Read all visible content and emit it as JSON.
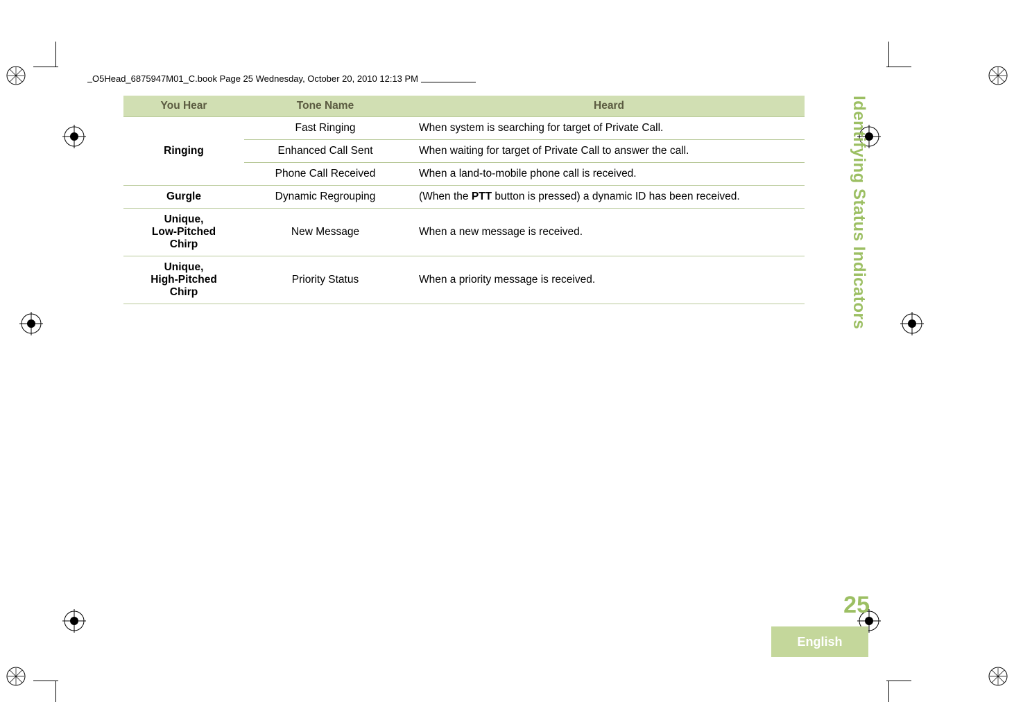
{
  "header_note": "O5Head_6875947M01_C.book  Page 25  Wednesday, October 20, 2010  12:13 PM",
  "table": {
    "headers": {
      "you_hear": "You Hear",
      "tone_name": "Tone Name",
      "heard": "Heard"
    },
    "rows": [
      {
        "you_hear": "",
        "tone_name": "Fast Ringing",
        "heard": "When system is searching for target of Private Call."
      },
      {
        "you_hear": "Ringing",
        "tone_name": "Enhanced Call Sent",
        "heard": "When waiting for target of Private Call to answer the call."
      },
      {
        "you_hear": "",
        "tone_name": "Phone Call Received",
        "heard": "When a land-to-mobile phone call is received."
      },
      {
        "you_hear": "Gurgle",
        "tone_name": "Dynamic Regrouping",
        "heard_pre": "(When the ",
        "heard_bold": "PTT",
        "heard_post": " button is pressed) a dynamic ID has been received."
      },
      {
        "you_hear": "Unique,\nLow-Pitched\nChirp",
        "tone_name": "New Message",
        "heard": "When a new message is received."
      },
      {
        "you_hear": "Unique,\nHigh-Pitched\nChirp",
        "tone_name": "Priority Status",
        "heard": "When a priority message is received."
      }
    ]
  },
  "side_tab": "Identifying Status Indicators",
  "page_number": "25",
  "language": "English"
}
